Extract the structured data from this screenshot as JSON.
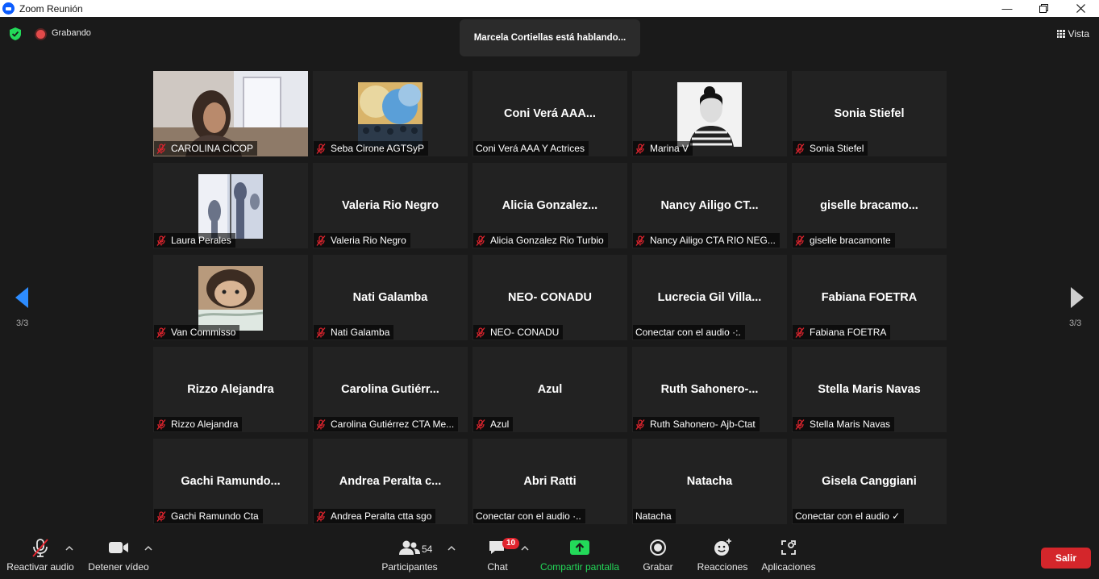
{
  "window": {
    "title": "Zoom Reunión"
  },
  "topbar": {
    "recording": "Grabando",
    "speaking": "Marcela Cortiellas está hablando...",
    "view": "Vista"
  },
  "pagination": {
    "left": "3/3",
    "right": "3/3"
  },
  "tiles": [
    {
      "label": "CAROLINA CICOP",
      "big": "",
      "muted": true,
      "media": "video"
    },
    {
      "label": "Seba Cirone AGTSyP",
      "big": "",
      "muted": true,
      "media": "avatar-crowd"
    },
    {
      "label": "Coni Verá AAA Y Actrices",
      "big": "Coni Verá AAA...",
      "muted": false,
      "media": "none"
    },
    {
      "label": "Marina V",
      "big": "",
      "muted": true,
      "media": "avatar-bw"
    },
    {
      "label": "Sonia Stiefel",
      "big": "Sonia Stiefel",
      "muted": true,
      "media": "none"
    },
    {
      "label": "Laura Perales",
      "big": "",
      "muted": true,
      "media": "avatar-shadow"
    },
    {
      "label": "Valeria Rio Negro",
      "big": "Valeria Rio Negro",
      "muted": true,
      "media": "none"
    },
    {
      "label": "Alicia Gonzalez Rio Turbio",
      "big": "Alicia  Gonzalez...",
      "muted": true,
      "media": "none"
    },
    {
      "label": "Nancy Ailigo CTA RIO NEG...",
      "big": "Nancy  Ailigo  CT...",
      "muted": true,
      "media": "none"
    },
    {
      "label": "giselle bracamonte",
      "big": "giselle  bracamo...",
      "muted": true,
      "media": "none"
    },
    {
      "label": "Van Commisso",
      "big": "",
      "muted": true,
      "media": "avatar-face"
    },
    {
      "label": "Nati Galamba",
      "big": "Nati Galamba",
      "muted": true,
      "media": "none"
    },
    {
      "label": "NEO- CONADU",
      "big": "NEO- CONADU",
      "muted": true,
      "media": "none"
    },
    {
      "label": "Conectar con el audio ·:.",
      "big": "Lucrecia  Gil  Villa...",
      "muted": false,
      "media": "none"
    },
    {
      "label": "Fabiana FOETRA",
      "big": "Fabiana FOETRA",
      "muted": true,
      "media": "none"
    },
    {
      "label": "Rizzo Alejandra",
      "big": "Rizzo Alejandra",
      "muted": true,
      "media": "none"
    },
    {
      "label": "Carolina Gutiérrez CTA Me...",
      "big": "Carolina  Gutiérr...",
      "muted": true,
      "media": "none"
    },
    {
      "label": "Azul",
      "big": "Azul",
      "muted": true,
      "media": "none"
    },
    {
      "label": "Ruth Sahonero- Ajb-Ctat",
      "big": "Ruth  Sahonero-...",
      "muted": true,
      "media": "none"
    },
    {
      "label": "Stella Maris Navas",
      "big": "Stella Maris Navas",
      "muted": true,
      "media": "none"
    },
    {
      "label": "Gachi Ramundo  Cta",
      "big": "Gachi  Ramundo...",
      "muted": true,
      "media": "none"
    },
    {
      "label": "Andrea Peralta ctta sgo",
      "big": "Andrea Peralta c...",
      "muted": true,
      "media": "none"
    },
    {
      "label": "Conectar con el audio ·..",
      "big": "Abri Ratti",
      "muted": false,
      "media": "none"
    },
    {
      "label": "Natacha",
      "big": "Natacha",
      "muted": false,
      "media": "none"
    },
    {
      "label": "Conectar con el audio ✓",
      "big": "Gisela Canggiani",
      "muted": false,
      "media": "none"
    }
  ],
  "toolbar": {
    "audio": "Reactivar audio",
    "video": "Detener vídeo",
    "participants": "Participantes",
    "participants_count": "54",
    "chat": "Chat",
    "chat_badge": "10",
    "share": "Compartir pantalla",
    "record": "Grabar",
    "reactions": "Reacciones",
    "apps": "Aplicaciones",
    "leave": "Salir"
  },
  "colors": {
    "share_green": "#23d959",
    "leave_red": "#d4262b",
    "nav_blue": "#2d8cff",
    "mute_red": "#e0242e"
  }
}
